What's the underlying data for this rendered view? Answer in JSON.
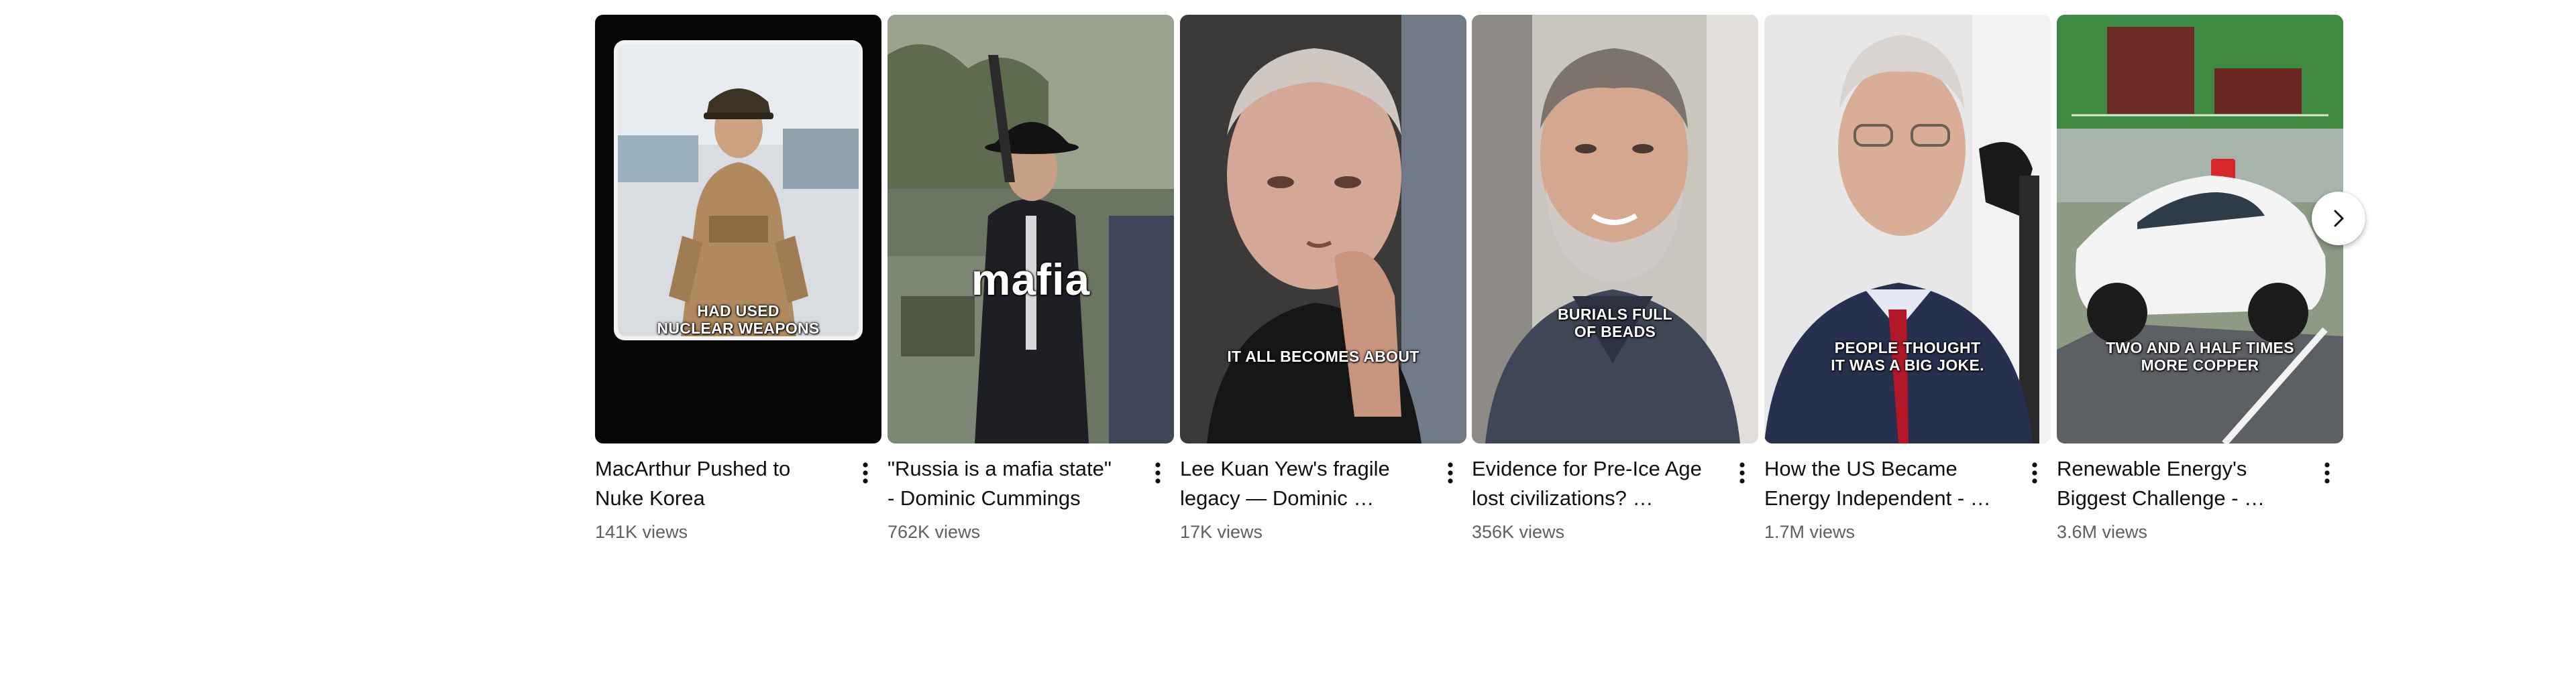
{
  "shelf": {
    "items": [
      {
        "title": "MacArthur Pushed to Nuke Korea",
        "views": "141K views",
        "thumb_caption": "HAD USED\nNUCLEAR WEAPONS"
      },
      {
        "title": "\"Russia is a mafia state\" - Dominic Cummings",
        "views": "762K views",
        "thumb_caption": "mafia"
      },
      {
        "title": "Lee Kuan Yew's fragile legacy — Dominic …",
        "views": "17K views",
        "thumb_caption": "IT ALL BECOMES ABOUT"
      },
      {
        "title": "Evidence for Pre-Ice Age lost civilizations? …",
        "views": "356K views",
        "thumb_caption": "BURIALS FULL\nOF BEADS"
      },
      {
        "title": "How the US Became Energy Independent - …",
        "views": "1.7M views",
        "thumb_caption": "PEOPLE THOUGHT\nIT WAS A BIG JOKE."
      },
      {
        "title": "Renewable Energy's Biggest Challenge - …",
        "views": "3.6M views",
        "thumb_caption": "TWO AND A HALF TIMES\nMORE COPPER"
      }
    ],
    "more_icon": "more-vert-icon",
    "next_icon": "chevron-right-icon"
  }
}
